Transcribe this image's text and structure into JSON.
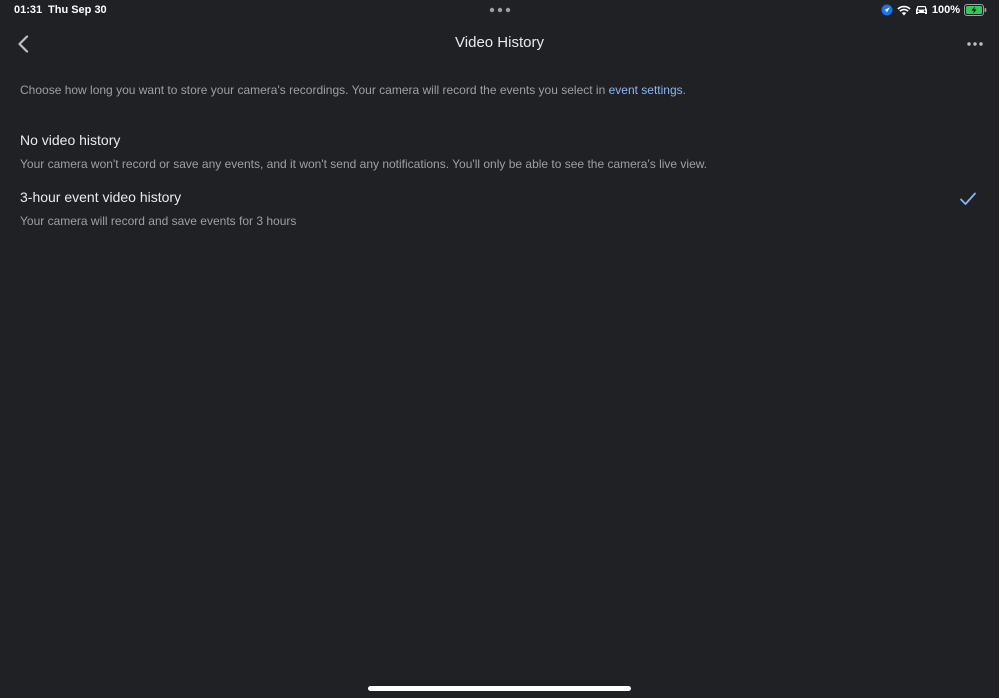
{
  "status_bar": {
    "time": "01:31",
    "date": "Thu Sep 30",
    "battery_percent": "100%",
    "icons": [
      "location-icon",
      "wifi-icon",
      "car-icon",
      "battery-charging-icon"
    ]
  },
  "app_bar": {
    "title": "Video History",
    "back_icon": "chevron-left-icon",
    "more_icon": "more-horizontal-icon"
  },
  "intro": {
    "text": "Choose how long you want to store your camera's recordings. Your camera will record the events you select in ",
    "link_text": "event settings",
    "suffix": "."
  },
  "options": [
    {
      "title": "No video history",
      "description": "Your camera won't record or save any events, and it won't send any notifications. You'll only be able to see the camera's live view.",
      "selected": false
    },
    {
      "title": "3-hour event video history",
      "description": "Your camera will record and save events for 3 hours",
      "selected": true
    }
  ],
  "colors": {
    "background": "#202124",
    "accent": "#8ab4f8",
    "text_primary": "#e8eaed",
    "text_secondary": "#9aa0a6"
  }
}
